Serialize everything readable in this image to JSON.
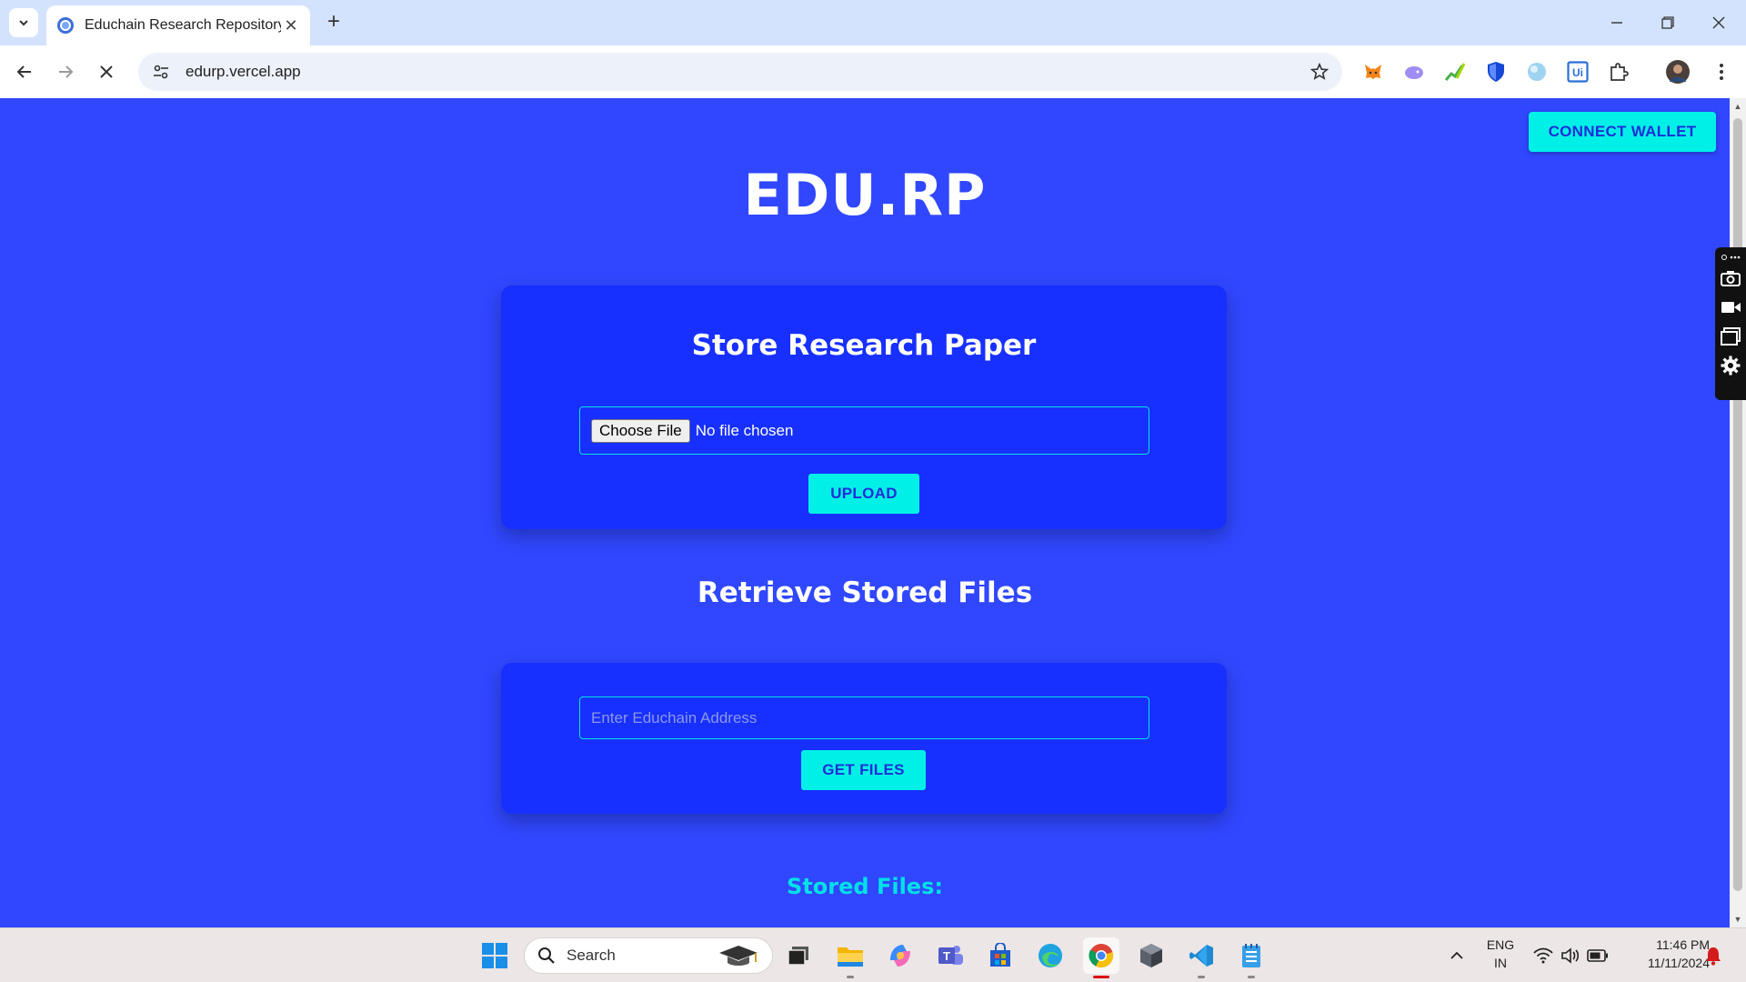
{
  "browser": {
    "tab_title": "Educhain Research Repository",
    "url": "edurp.vercel.app"
  },
  "page": {
    "connect_wallet_label": "CONNECT WALLET",
    "brand": "EDU.RP",
    "store_section": {
      "title": "Store Research Paper",
      "choose_file_label": "Choose File",
      "file_status": "No file chosen",
      "upload_label": "UPLOAD"
    },
    "retrieve_section": {
      "title": "Retrieve Stored Files",
      "address_placeholder": "Enter Educhain Address",
      "get_files_label": "GET FILES"
    },
    "stored_files_title": "Stored Files:"
  },
  "taskbar": {
    "search_label": "Search",
    "language_line1": "ENG",
    "language_line2": "IN",
    "time": "11:46 PM",
    "date": "11/11/2024"
  },
  "colors": {
    "page_bg": "#3047ff",
    "card_bg": "#1730ff",
    "accent": "#00f0e8",
    "accent_text": "#1e2fd6"
  }
}
